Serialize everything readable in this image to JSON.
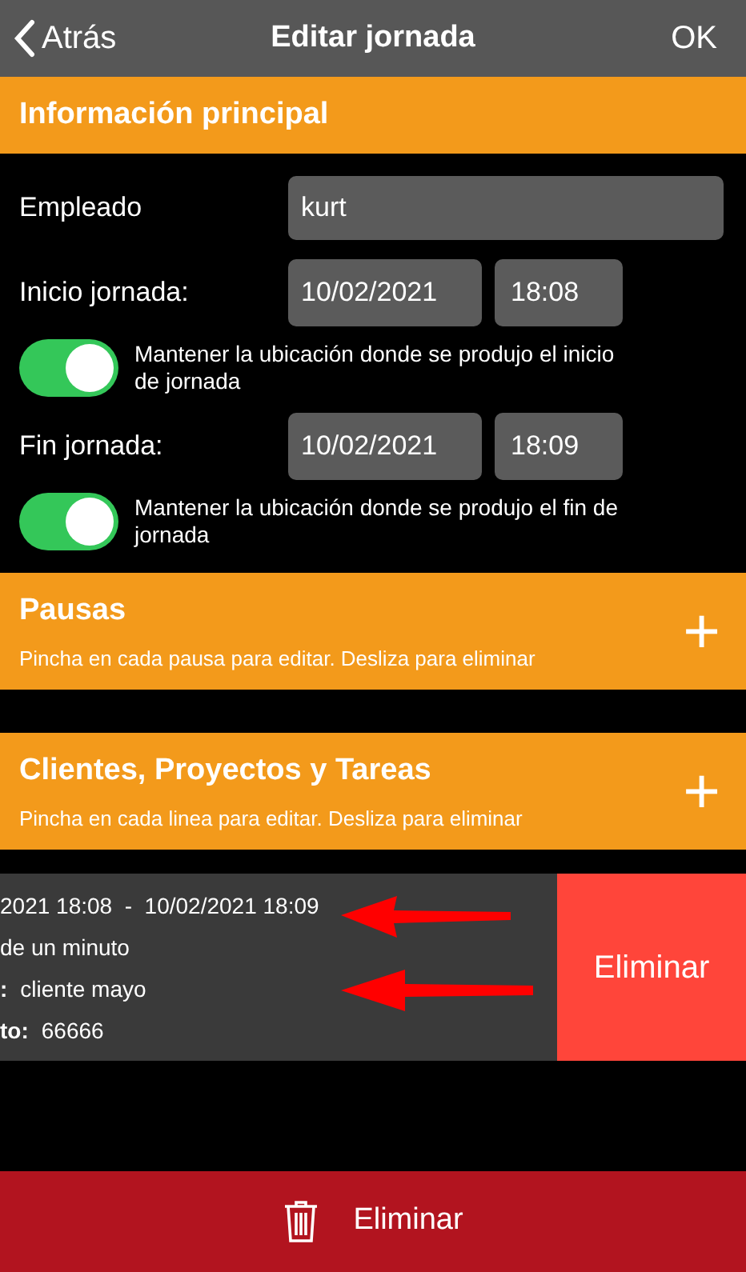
{
  "nav": {
    "back": "Atrás",
    "title": "Editar jornada",
    "action": "OK"
  },
  "main_section": {
    "title": "Información principal"
  },
  "employee": {
    "label": "Empleado",
    "value": "kurt"
  },
  "start": {
    "label": "Inicio jornada:",
    "date": "10/02/2021",
    "time": "18:08",
    "keep_location": {
      "on": true,
      "label": "Mantener la ubicación donde se produjo el inicio de jornada"
    }
  },
  "end": {
    "label": "Fin jornada:",
    "date": "10/02/2021",
    "time": "18:09",
    "keep_location": {
      "on": true,
      "label": "Mantener la ubicación donde se produjo el fin de jornada"
    }
  },
  "sections": [
    {
      "title": "Pausas",
      "subtitle": "Pincha en cada pausa para editar. Desliza para eliminar",
      "add": "+"
    },
    {
      "title": "Clientes, Proyectos y Tareas",
      "subtitle": "Pincha en cada linea para editar. Desliza para eliminar",
      "add": "+"
    }
  ],
  "entry": {
    "lines": [
      {
        "value": "2021 18:08  -  10/02/2021 18:09"
      },
      {
        "value": "de un minuto"
      },
      {
        "label": ":",
        "value": "cliente mayo"
      },
      {
        "label": "to:",
        "value": "66666"
      }
    ],
    "swipe_action": "Eliminar"
  },
  "bottom_button": {
    "label": "Eliminar"
  }
}
